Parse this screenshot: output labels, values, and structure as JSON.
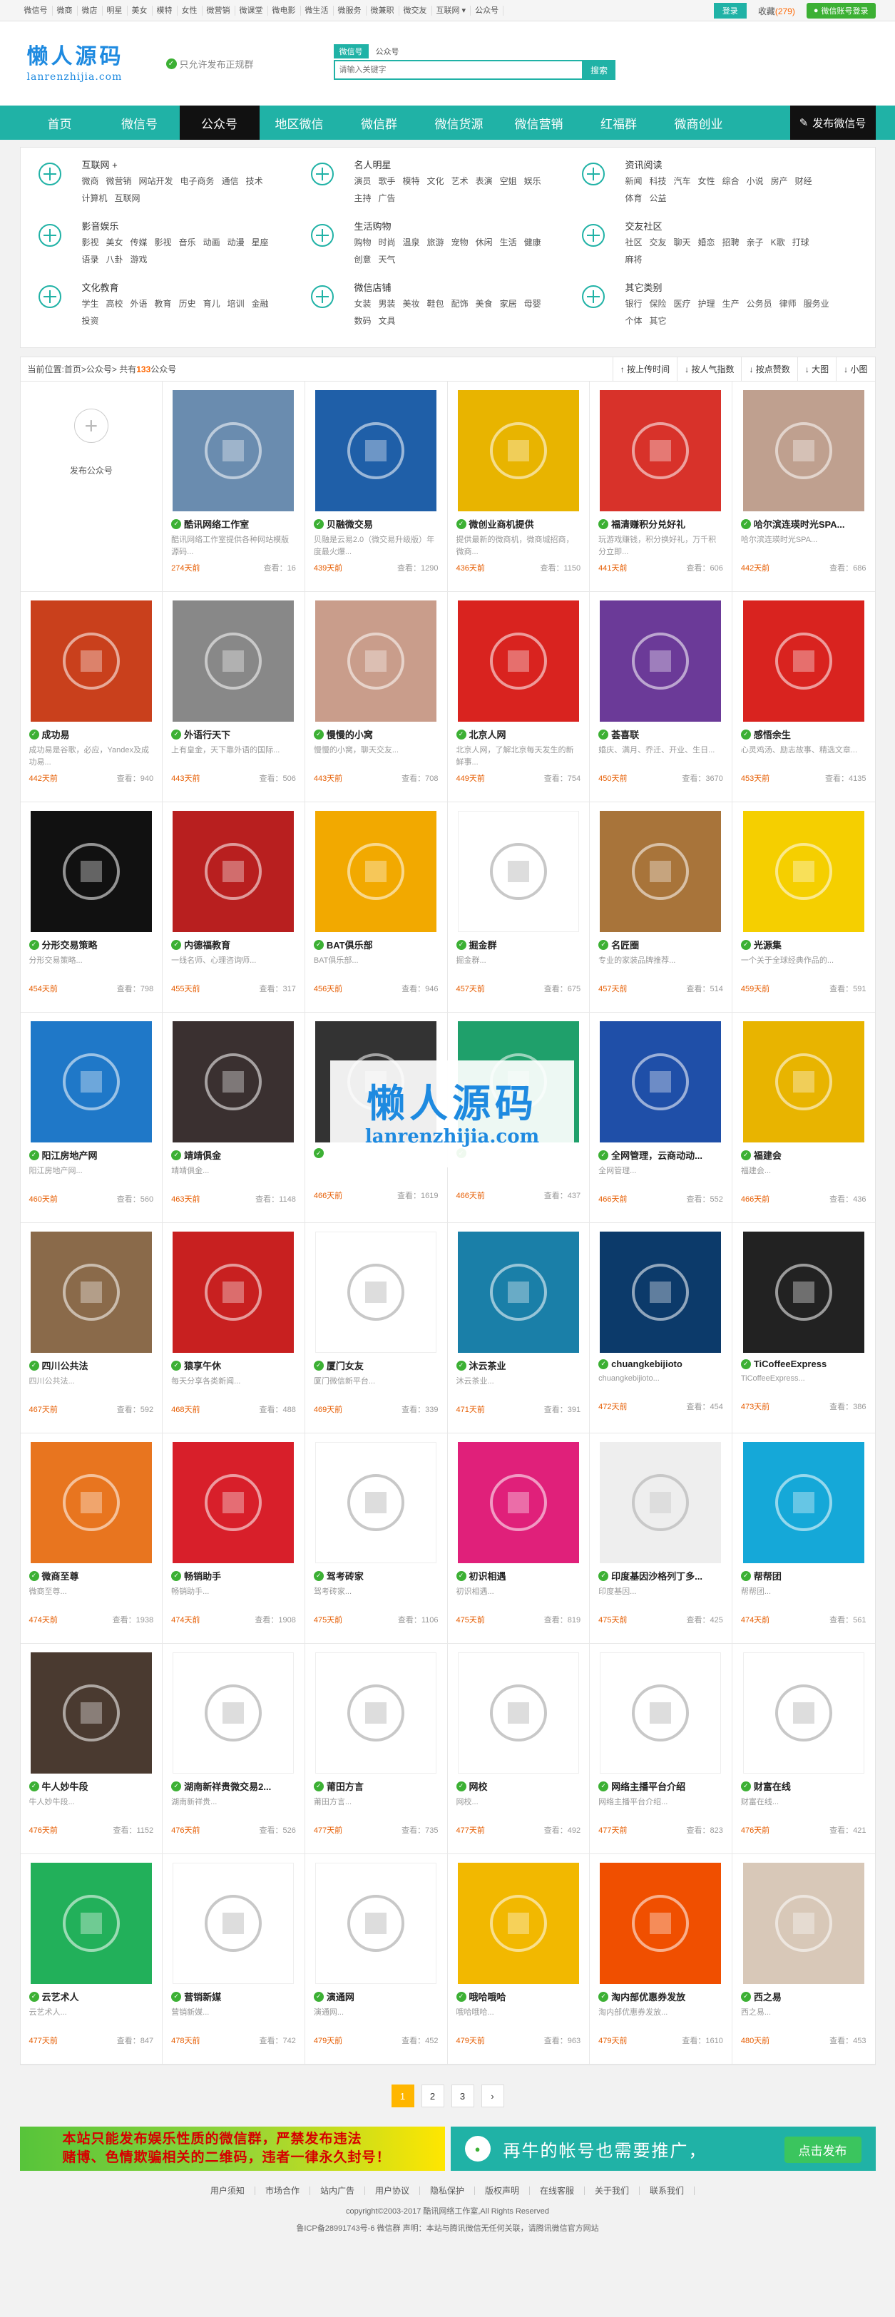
{
  "topbar": {
    "links": [
      "微信号",
      "微商",
      "微店",
      "明星",
      "美女",
      "模特",
      "女性",
      "微营销",
      "微课堂",
      "微电影",
      "微生活",
      "微服务",
      "微兼职",
      "微交友",
      "互联网 ▾",
      "公众号"
    ],
    "login_label": "登录",
    "favorites_label": "收藏",
    "favorites_count": "(279)",
    "wx_login_label": "微信账号登录"
  },
  "header": {
    "logo_cn": "懒人源码",
    "logo_en": "lanrenzhijia.com",
    "slogan": "只允许发布正规群",
    "search_tabs": [
      "微信号",
      "公众号"
    ],
    "search_placeholder": "请输入关键字",
    "search_button": "搜索"
  },
  "nav": {
    "items": [
      "首页",
      "微信号",
      "公众号",
      "地区微信",
      "微信群",
      "微信货源",
      "微信营销",
      "红福群",
      "微商创业"
    ],
    "publish_label": "发布微信号"
  },
  "categories": [
    {
      "title": "互联网 +",
      "links": [
        "微商",
        "微营销",
        "网站开发",
        "电子商务",
        "通信",
        "技术",
        "计算机",
        "互联网"
      ]
    },
    {
      "title": "名人明星",
      "links": [
        "演员",
        "歌手",
        "模特",
        "文化",
        "艺术",
        "表演",
        "空姐",
        "娱乐",
        "主持",
        "广告"
      ]
    },
    {
      "title": "资讯阅读",
      "links": [
        "新闻",
        "科技",
        "汽车",
        "女性",
        "综合",
        "小说",
        "房产",
        "财经",
        "体育",
        "公益"
      ]
    },
    {
      "title": "影音娱乐",
      "links": [
        "影视",
        "美女",
        "传媒",
        "影视",
        "音乐",
        "动画",
        "动漫",
        "星座",
        "语录",
        "八卦",
        "游戏"
      ]
    },
    {
      "title": "生活购物",
      "links": [
        "购物",
        "时尚",
        "温泉",
        "旅游",
        "宠物",
        "休闲",
        "生活",
        "健康",
        "创意",
        "天气"
      ]
    },
    {
      "title": "交友社区",
      "links": [
        "社区",
        "交友",
        "聊天",
        "婚恋",
        "招聘",
        "亲子",
        "K歌",
        "打球",
        "麻将"
      ]
    },
    {
      "title": "文化教育",
      "links": [
        "学生",
        "高校",
        "外语",
        "教育",
        "历史",
        "育儿",
        "培训",
        "金融",
        "投资"
      ]
    },
    {
      "title": "微信店铺",
      "links": [
        "女装",
        "男装",
        "美妆",
        "鞋包",
        "配饰",
        "美食",
        "家居",
        "母婴",
        "数码",
        "文具"
      ]
    },
    {
      "title": "其它类别",
      "links": [
        "银行",
        "保险",
        "医疗",
        "护理",
        "生产",
        "公务员",
        "律师",
        "服务业",
        "个体",
        "其它"
      ]
    }
  ],
  "listbar": {
    "prefix": "当前位置:",
    "crumb1": "首页",
    "sep": " > ",
    "crumb2": "公众号",
    "total_prefix": " > 共有 ",
    "total": "133",
    "total_suffix": "公众号",
    "sorts": [
      "↑ 按上传时间",
      "↓ 按人气指数",
      "↓ 按点赞数",
      "↓ 大图",
      "↓ 小图"
    ]
  },
  "add_card": {
    "label": "发布公众号"
  },
  "cards": [
    {
      "name": "酷讯网络工作室",
      "desc": "酷讯网络工作室提供各种网站模版源码...",
      "time": "274天前",
      "views": "查看：16",
      "color": "#6a8caf"
    },
    {
      "name": "贝融微交易",
      "desc": "贝融是云易2.0（微交易升级版）年度最火爆...",
      "time": "439天前",
      "views": "查看：1290",
      "color": "#1f5fa8"
    },
    {
      "name": "微创业商机提供",
      "desc": "提供最新的微商机，微商城招商，微商...",
      "time": "436天前",
      "views": "查看：1150",
      "color": "#e8b400"
    },
    {
      "name": "福清赚积分兑好礼",
      "desc": "玩游戏赚钱，积分换好礼，万千积分立即...",
      "time": "441天前",
      "views": "查看：606",
      "color": "#d8322a"
    },
    {
      "name": "哈尔滨连瑛时光SPA...",
      "desc": "哈尔滨连瑛时光SPA...",
      "time": "442天前",
      "views": "查看：686",
      "color": "#bfa08f"
    },
    {
      "name": "成功易",
      "desc": "成功易是谷歌，必应，Yandex及成功易...",
      "time": "442天前",
      "views": "查看：940",
      "color": "#c9401c"
    },
    {
      "name": "外语行天下",
      "desc": "上有皇金，天下靠外语的国际...",
      "time": "443天前",
      "views": "查看：506",
      "color": "#888888"
    },
    {
      "name": "慢慢的小窝",
      "desc": "慢慢的小窝，聊天交友...",
      "time": "443天前",
      "views": "查看：708",
      "color": "#c99d8b"
    },
    {
      "name": "北京人网",
      "desc": "北京人网，了解北京每天发生的新鲜事...",
      "time": "449天前",
      "views": "查看：754",
      "color": "#d9231f"
    },
    {
      "name": "荟喜联",
      "desc": "婚庆、满月、乔迁、开业、生日...",
      "time": "450天前",
      "views": "查看：3670",
      "color": "#6b3a98"
    },
    {
      "name": "感悟余生",
      "desc": "心灵鸡汤、励志故事、精选文章...",
      "time": "453天前",
      "views": "查看：4135",
      "color": "#d9231f"
    },
    {
      "name": "分形交易策略",
      "desc": "分形交易策略...",
      "time": "454天前",
      "views": "查看：798",
      "color": "#111111"
    },
    {
      "name": "内德福教育",
      "desc": "一线名师、心理咨询师...",
      "time": "455天前",
      "views": "查看：317",
      "color": "#b81f1f"
    },
    {
      "name": "BAT俱乐部",
      "desc": "BAT俱乐部...",
      "time": "456天前",
      "views": "查看：946",
      "color": "#f2a900"
    },
    {
      "name": "掘金群",
      "desc": "掘金群...",
      "time": "457天前",
      "views": "查看：675",
      "color": "#ffffff"
    },
    {
      "name": "名匠圈",
      "desc": "专业的家装品牌推荐...",
      "time": "457天前",
      "views": "查看：514",
      "color": "#a8743a"
    },
    {
      "name": "光源集",
      "desc": "一个关于全球经典作品的...",
      "time": "459天前",
      "views": "查看：591",
      "color": "#f5cf00"
    },
    {
      "name": "阳江房地产网",
      "desc": "阳江房地产网...",
      "time": "460天前",
      "views": "查看：560",
      "color": "#1f78c8"
    },
    {
      "name": "靖靖俱金",
      "desc": "靖靖俱金...",
      "time": "463天前",
      "views": "查看：1148",
      "color": "#3a3030"
    },
    {
      "name": "",
      "desc": "",
      "time": "466天前",
      "views": "查看：1619",
      "color": "#333333"
    },
    {
      "name": "",
      "desc": "",
      "time": "466天前",
      "views": "查看：437",
      "color": "#1fa06b"
    },
    {
      "name": "全网管理，云商动动...",
      "desc": "全网管理...",
      "time": "466天前",
      "views": "查看：552",
      "color": "#1f4fa8"
    },
    {
      "name": "福建会",
      "desc": "福建会...",
      "time": "466天前",
      "views": "查看：436",
      "color": "#e8b400"
    },
    {
      "name": "四川公共法",
      "desc": "四川公共法...",
      "time": "467天前",
      "views": "查看：592",
      "color": "#8a6a4a"
    },
    {
      "name": "猿享午休",
      "desc": "每天分享各类新闻...",
      "time": "468天前",
      "views": "查看：488",
      "color": "#c82020"
    },
    {
      "name": "厦门女友",
      "desc": "厦门微信新平台...",
      "time": "469天前",
      "views": "查看：339",
      "color": "#ffffff"
    },
    {
      "name": "沐云茶业",
      "desc": "沐云茶业...",
      "time": "471天前",
      "views": "查看：391",
      "color": "#1a7fa8"
    },
    {
      "name": "chuangkebijioto",
      "desc": "chuangkebijioto...",
      "time": "472天前",
      "views": "查看：454",
      "color": "#0c3a6a"
    },
    {
      "name": "TiCoffeeExpress",
      "desc": "TiCoffeeExpress...",
      "time": "473天前",
      "views": "查看：386",
      "color": "#222222"
    },
    {
      "name": "微商至尊",
      "desc": "微商至尊...",
      "time": "474天前",
      "views": "查看：1938",
      "color": "#e8751f"
    },
    {
      "name": "畅销助手",
      "desc": "畅销助手...",
      "time": "474天前",
      "views": "查看：1908",
      "color": "#d81f2a"
    },
    {
      "name": "驾考砖家",
      "desc": "驾考砖家...",
      "time": "475天前",
      "views": "查看：1106",
      "color": "#ffffff"
    },
    {
      "name": "初识相遇",
      "desc": "初识相遇...",
      "time": "475天前",
      "views": "查看：819",
      "color": "#e0207a"
    },
    {
      "name": "印度基因沙格列丁多...",
      "desc": "印度基因...",
      "time": "475天前",
      "views": "查看：425",
      "color": "#eeeeee"
    },
    {
      "name": "帮帮团",
      "desc": "帮帮团...",
      "time": "474天前",
      "views": "查看：561",
      "color": "#15a8d8"
    },
    {
      "name": "牛人妙牛段",
      "desc": "牛人妙牛段...",
      "time": "476天前",
      "views": "查看：1152",
      "color": "#4a3a30"
    },
    {
      "name": "湖南新祥贵微交易2...",
      "desc": "湖南新祥贵...",
      "time": "476天前",
      "views": "查看：526",
      "color": "#ffffff"
    },
    {
      "name": "莆田方言",
      "desc": "莆田方言...",
      "time": "477天前",
      "views": "查看：735",
      "color": "#ffffff"
    },
    {
      "name": "网校",
      "desc": "网校...",
      "time": "477天前",
      "views": "查看：492",
      "color": "#ffffff"
    },
    {
      "name": "网络主播平台介绍",
      "desc": "网络主播平台介绍...",
      "time": "477天前",
      "views": "查看：823",
      "color": "#ffffff"
    },
    {
      "name": "财富在线",
      "desc": "财富在线...",
      "time": "476天前",
      "views": "查看：421",
      "color": "#ffffff"
    },
    {
      "name": "云艺术人",
      "desc": "云艺术人...",
      "time": "477天前",
      "views": "查看：847",
      "color": "#22b05a"
    },
    {
      "name": "营销新媒",
      "desc": "营销新媒...",
      "time": "478天前",
      "views": "查看：742",
      "color": "#ffffff"
    },
    {
      "name": "演通网",
      "desc": "演通网...",
      "time": "479天前",
      "views": "查看：452",
      "color": "#ffffff"
    },
    {
      "name": "哦哈哦哈",
      "desc": "哦哈哦哈...",
      "time": "479天前",
      "views": "查看：963",
      "color": "#f2b800"
    },
    {
      "name": "淘内部优惠券发放",
      "desc": "淘内部优惠券发放...",
      "time": "479天前",
      "views": "查看：1610",
      "color": "#f04f00"
    },
    {
      "name": "西之易",
      "desc": "西之易...",
      "time": "480天前",
      "views": "查看：453",
      "color": "#d8c8b8"
    }
  ],
  "pager": [
    "1",
    "2",
    "3",
    "›"
  ],
  "ads": {
    "ad1_line1": "本站只能发布娱乐性质的微信群，严禁发布违法",
    "ad1_line2": "赌博、色情欺骗相关的二维码，违者一律永久封号！",
    "ad2_text": "再牛的帐号也需要推广，",
    "ad2_button": "点击发布"
  },
  "footer": {
    "links": [
      "用户须知",
      "市场合作",
      "站内广告",
      "用户协议",
      "隐私保护",
      "版权声明",
      "在线客服",
      "关于我们",
      "联系我们"
    ],
    "copyright": "copyright©2003-2017 酷讯网络工作室,All Rights Reserved",
    "icp": "鲁ICP备28991743号-6 微信群  声明：本站与腾讯微信无任何关联，请腾讯微信官方网站"
  },
  "watermark": {
    "cn": "懒人源码",
    "en": "lanrenzhijia.com"
  }
}
